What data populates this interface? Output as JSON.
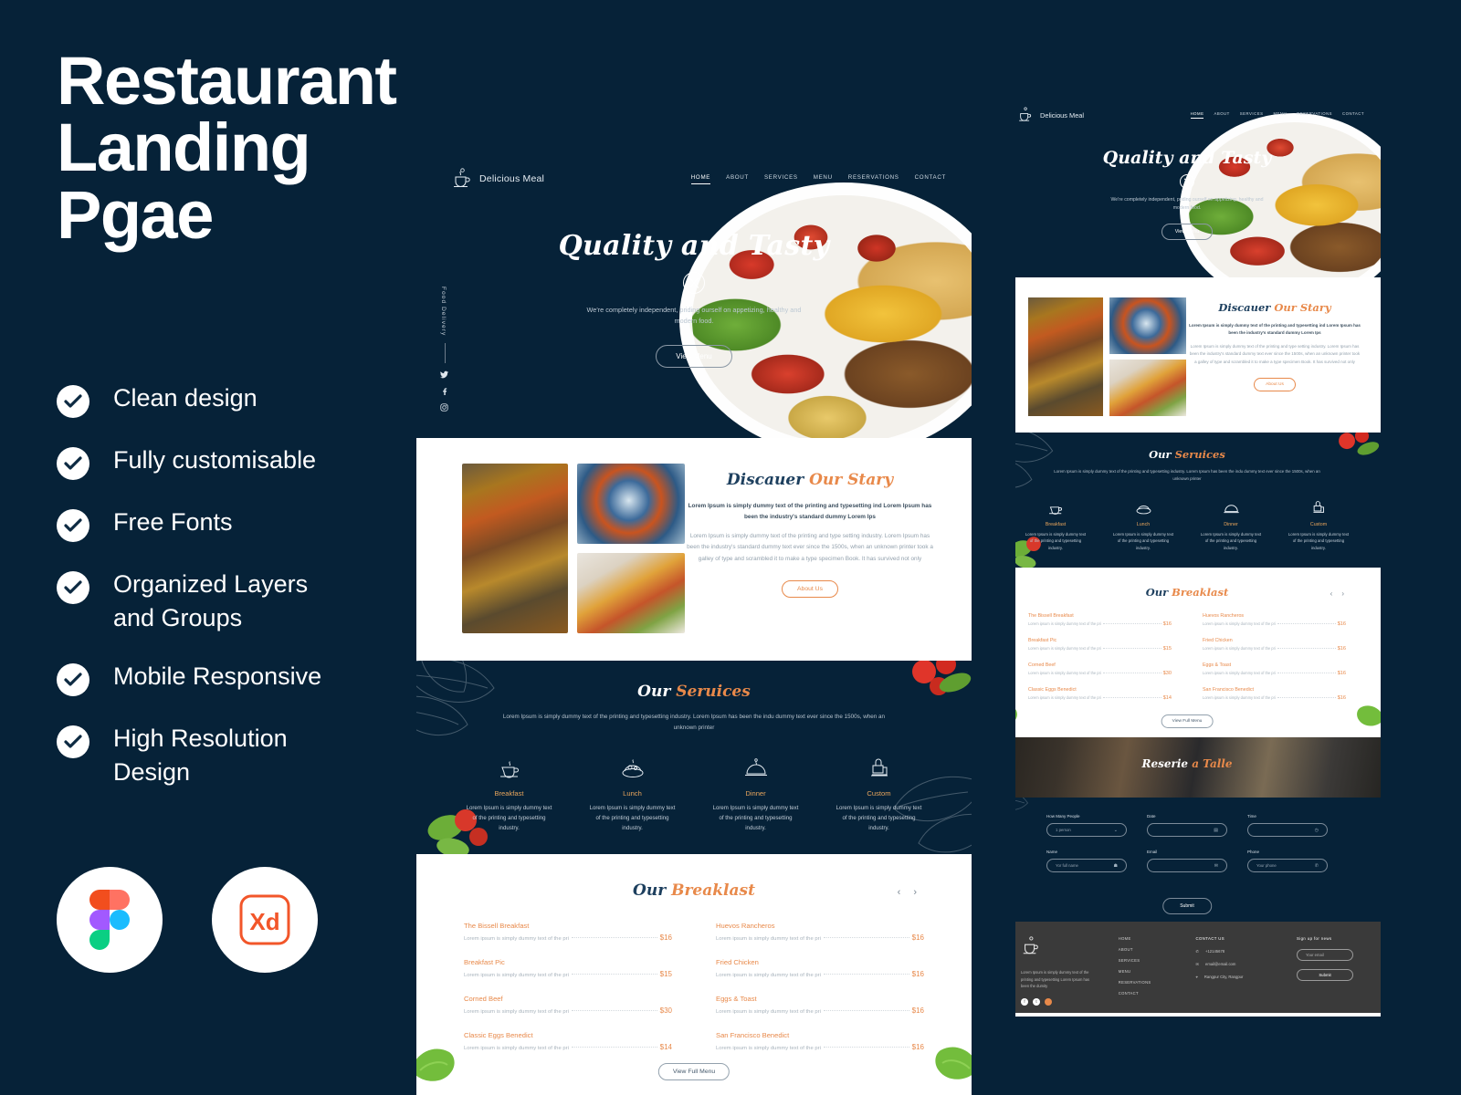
{
  "promo": {
    "title": "Restaurant\nLanding\nPgae",
    "features": [
      "Clean design",
      "Fully customisable",
      "Free  Fonts",
      "Organized Layers\nand Groups",
      "Mobile Responsive",
      "High Resolution\nDesign"
    ],
    "tools": [
      "figma-logo",
      "adobe-xd-logo"
    ]
  },
  "colors": {
    "background": "#062238",
    "accent_orange": "#e8894a",
    "navy_text": "#1d3f5e",
    "footer_bg": "#3a3a3a"
  },
  "site": {
    "brand": "Delicious Meal",
    "nav": [
      {
        "label": "HOME",
        "active": true
      },
      {
        "label": "ABOUT",
        "active": false
      },
      {
        "label": "SERVICES",
        "active": false
      },
      {
        "label": "MENU",
        "active": false
      },
      {
        "label": "RESERVATIONS",
        "active": false
      },
      {
        "label": "CONTACT",
        "active": false
      }
    ],
    "hero": {
      "title": "Quality and Tasty",
      "subtitle": "We're completely independent, priding ourself on appetizing, healthy and modern food.",
      "cta": "View Menu",
      "side_label": "Food Delivery",
      "socials": [
        "twitter-icon",
        "facebook-icon",
        "instagram-icon"
      ]
    },
    "story": {
      "title_part1": "Discauer ",
      "title_part2": "Our Stary",
      "lead": "Lorem Ipsum is simply dummy text of the printing and typesetting ind Lorem Ipsum has been the industry's standard dummy Lorem Ips",
      "body": "Lorem Ipsum is simply dummy text of the printing and type setting industry. Lorem Ipsum has been the industry's standard dummy text ever since the 1500s, when an unknown printer took a galley of type and scrambled it to make a type specimen Book. It has survived not only",
      "cta": "About Us"
    },
    "services": {
      "title_part1": "Our ",
      "title_part2": "Seruices",
      "subtitle": "Lorem Ipsum is simply dummy text of the printing and typesetting industry. Lorem Ipsum has been the indu dummy text ever since the 1500s, when an unknown printer",
      "cards": [
        {
          "icon": "coffee-cup-icon",
          "title": "Breakfast",
          "desc": "Lorem Ipsum is simply dummy text of the printing and typesetting industry."
        },
        {
          "icon": "lunch-plate-icon",
          "title": "Lunch",
          "desc": "Lorem Ipsum is simply dummy text of the printing and typesetting industry."
        },
        {
          "icon": "dinner-cloche-icon",
          "title": "Dinner",
          "desc": "Lorem Ipsum is simply dummy text of the printing and typesetting industry."
        },
        {
          "icon": "custom-chef-icon",
          "title": "Custom",
          "desc": "Lorem Ipsum is simply dummy text of the printing and typesetting industry."
        }
      ]
    },
    "menu": {
      "title_part1": "Our ",
      "title_part2": "Breaklast",
      "prev": "‹",
      "next": "›",
      "item_desc": "Lorem ipsum is simply dummy text of the pri",
      "left": [
        {
          "name": "The Bissell Breakfast",
          "price": "$16"
        },
        {
          "name": "Breakfast Pic",
          "price": "$15"
        },
        {
          "name": "Corned Beef",
          "price": "$30"
        },
        {
          "name": "Classic Eggs Benedict",
          "price": "$14"
        }
      ],
      "right": [
        {
          "name": "Huevos Rancheros",
          "price": "$16"
        },
        {
          "name": "Fried Chicken",
          "price": "$16"
        },
        {
          "name": "Eggs & Toast",
          "price": "$16"
        },
        {
          "name": "San Francisco Benedict",
          "price": "$16"
        }
      ],
      "cta": "View Full Menu"
    },
    "reservation": {
      "title_part1": "Reserie ",
      "title_part2": "a Talle",
      "fields": [
        {
          "label": "How Many People",
          "value": "1 person",
          "icon": "chevron-down-icon"
        },
        {
          "label": "Date",
          "value": "",
          "icon": "calendar-icon"
        },
        {
          "label": "Time",
          "value": "",
          "icon": "clock-icon"
        },
        {
          "label": "Name",
          "value": "Yor full name",
          "icon": "user-icon"
        },
        {
          "label": "Email",
          "value": "",
          "icon": "mail-icon"
        },
        {
          "label": "Phone",
          "value": "Your phone",
          "icon": "phone-icon"
        }
      ],
      "submit": "Submit"
    },
    "footer": {
      "desc": "Lorem Ipsum is simply dummy text of the printing and typesetting Lorem Ipsum has been the dumity",
      "socials": [
        "facebook-icon",
        "twitter-icon",
        "instagram-icon"
      ],
      "links": [
        "HOME",
        "ABOUT",
        "SERVICES",
        "MENU",
        "RESERVATIONS",
        "CONTACT"
      ],
      "contact_heading": "CONTACT US",
      "contact": [
        {
          "icon": "phone-icon",
          "text": "+12145678"
        },
        {
          "icon": "mail-icon",
          "text": "email@email.com"
        },
        {
          "icon": "pin-icon",
          "text": "Rangpur City, Rangpur"
        }
      ],
      "newsletter_heading": "Sign up for news",
      "newsletter_placeholder": "Your email",
      "newsletter_submit": "Submit"
    }
  }
}
